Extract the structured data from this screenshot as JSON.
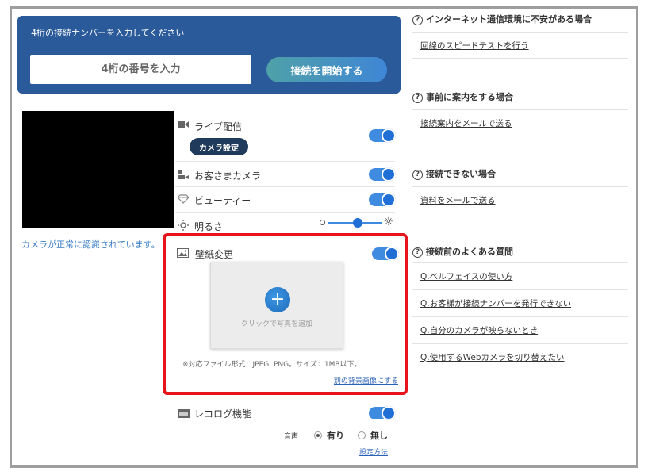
{
  "connect": {
    "title": "4桁の接続ナンバーを入力してください",
    "input_placeholder": "4桁の番号を入力",
    "start_button": "接続を開始する"
  },
  "camera": {
    "status": "カメラが正常に認識されています。"
  },
  "settings": {
    "live": {
      "label": "ライブ配信",
      "button": "カメラ設定",
      "enabled": true
    },
    "guest_camera": {
      "label": "お客さまカメラ",
      "enabled": true
    },
    "beauty": {
      "label": "ビューティー",
      "enabled": true
    },
    "brightness": {
      "label": "明るさ",
      "level": 0.55
    },
    "wallpaper": {
      "label": "壁紙変更",
      "enabled": true,
      "add_label": "クリックで写真を追加",
      "file_note": "※対応ファイル形式：JPEG, PNG。サイズ：1MB以下。",
      "alt_link": "別の背景画像にする"
    },
    "recolog": {
      "label": "レコログ機能",
      "enabled": true
    },
    "audio": {
      "label": "音声",
      "option_on": "有り",
      "option_off": "無し",
      "selected": "有り",
      "setup_link": "設定方法"
    }
  },
  "help": [
    {
      "heading": "インターネット通信環境に不安がある場合",
      "links": [
        "回線のスピードテストを行う"
      ]
    },
    {
      "heading": "事前に案内をする場合",
      "links": [
        "接続案内をメールで送る"
      ]
    },
    {
      "heading": "接続できない場合",
      "links": [
        "資料をメールで送る"
      ]
    },
    {
      "heading": "接続前のよくある質問",
      "links": [
        "Q.ベルフェイスの使い方",
        "Q.お客様が接続ナンバーを発行できない",
        "Q.自分のカメラが映らないとき",
        "Q.使用するWebカメラを切り替えたい"
      ]
    }
  ],
  "colors": {
    "panel": "#2a5a9a",
    "accent": "#3f8be0",
    "highlight": "#e8141b",
    "link": "#2a62b8"
  }
}
